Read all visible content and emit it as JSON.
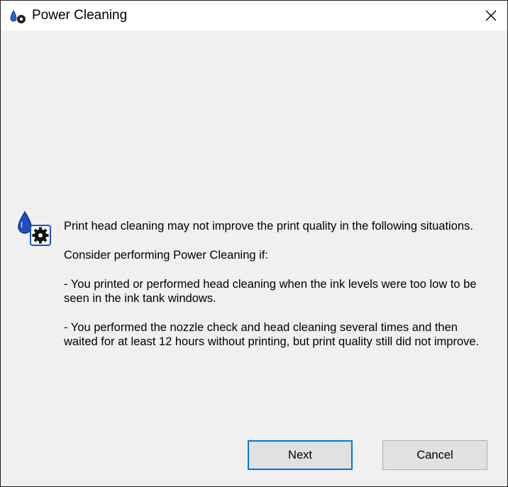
{
  "window": {
    "title": "Power Cleaning",
    "title_icon": "printer-cleaning-icon",
    "close_icon": "close-icon"
  },
  "dialog": {
    "icon": "ink-drop-gear-icon",
    "message_lines": [
      "Print head cleaning may not improve the print quality in the following situations.",
      "Consider performing Power Cleaning if:",
      "- You printed or performed head cleaning when the ink levels were too low to be seen in the ink tank windows.",
      "- You performed the nozzle check and head cleaning several times and then waited for at least 12 hours without printing, but print quality still did not improve."
    ]
  },
  "buttons": {
    "next_label": "Next",
    "cancel_label": "Cancel"
  },
  "colors": {
    "focus_border": "#0078d7",
    "dialog_background": "#f0f0f0",
    "icon_blue": "#1f4fbf"
  }
}
